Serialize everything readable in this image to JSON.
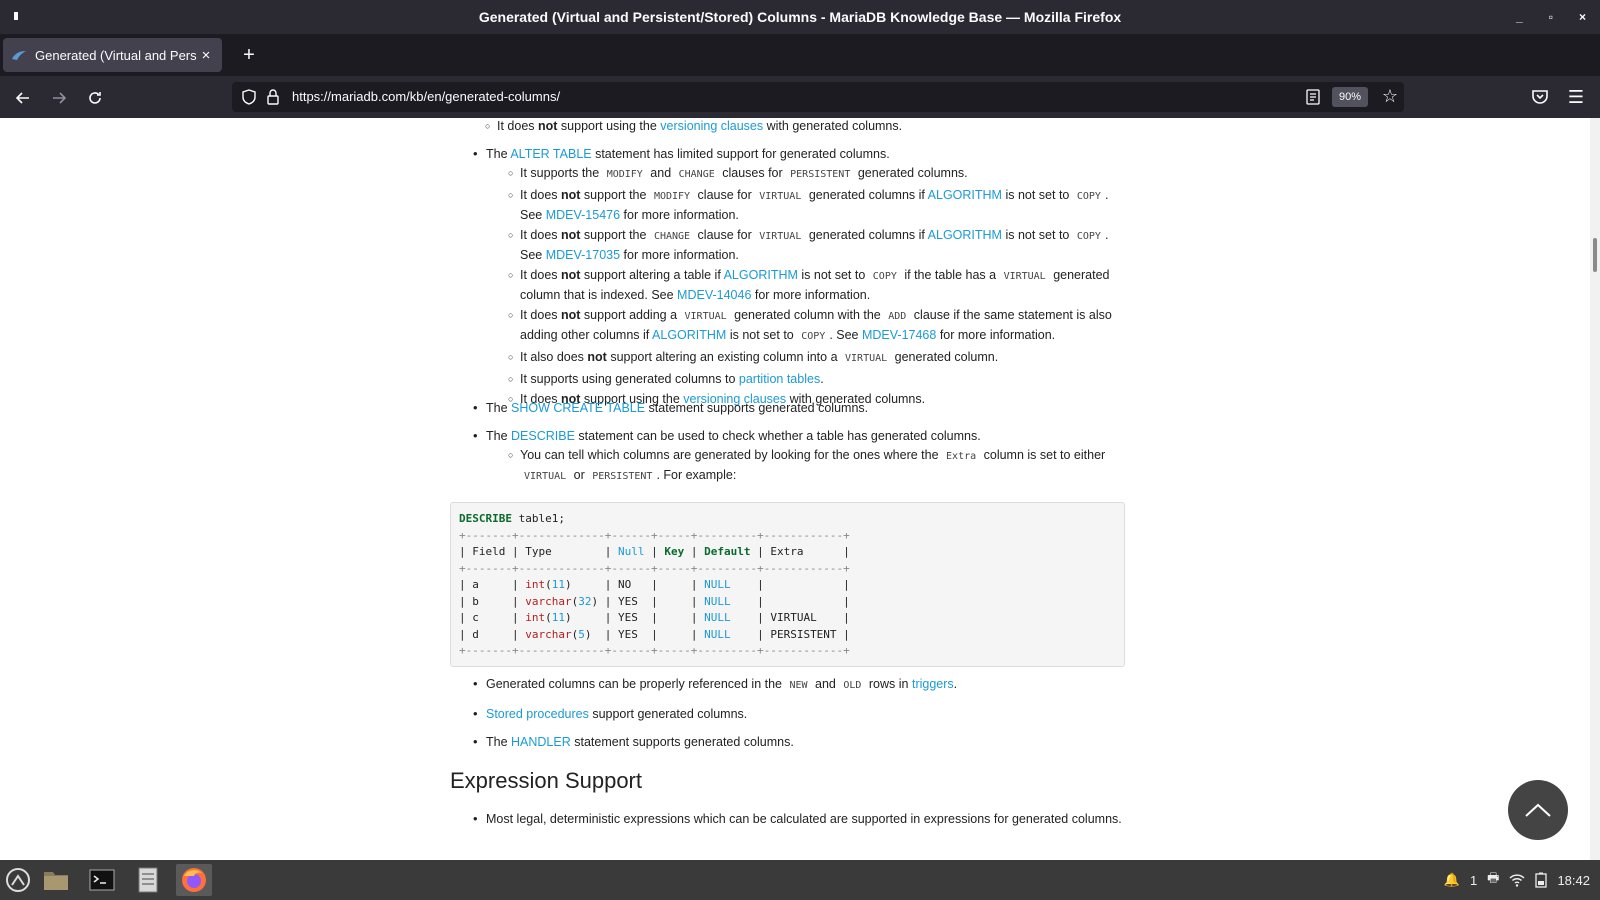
{
  "window": {
    "title": "Generated (Virtual and Persistent/Stored) Columns - MariaDB Knowledge Base — Mozilla Firefox",
    "controls": [
      "_",
      "▫",
      "×"
    ]
  },
  "tab": {
    "label": "Generated (Virtual and Pers",
    "close": "×",
    "new_tab": "+"
  },
  "nav": {
    "url": "https://mariadb.com/kb/en/generated-columns/",
    "zoom": "90%"
  },
  "content": {
    "top_item": {
      "pre": "It does ",
      "bold": "not",
      "mid": " support using the ",
      "link": "versioning clauses",
      "post": " with generated columns."
    },
    "alter": {
      "pre": "The ",
      "link": "ALTER TABLE",
      "post": " statement has limited support for generated columns.",
      "items": [
        {
          "t1": "It supports the ",
          "c1": "MODIFY",
          "t2": " and ",
          "c2": "CHANGE",
          "t3": " clauses for ",
          "c3": "PERSISTENT",
          "t4": " generated columns."
        },
        {
          "t1": "It does ",
          "b": "not",
          "t2": " support the ",
          "c1": "MODIFY",
          "t3": " clause for ",
          "c2": "VIRTUAL",
          "t4": " generated columns if ",
          "l1": "ALGORITHM",
          "t5": " is not set to ",
          "c3": "COPY",
          "t6": ". See ",
          "l2": "MDEV-15476",
          "t7": " for more information."
        },
        {
          "t1": "It does ",
          "b": "not",
          "t2": " support the ",
          "c1": "CHANGE",
          "t3": " clause for ",
          "c2": "VIRTUAL",
          "t4": " generated columns if ",
          "l1": "ALGORITHM",
          "t5": " is not set to ",
          "c3": "COPY",
          "t6": ". See ",
          "l2": "MDEV-17035",
          "t7": " for more information."
        },
        {
          "t1": "It does ",
          "b": "not",
          "t2": " support altering a table if ",
          "l1": "ALGORITHM",
          "t3": " is not set to ",
          "c1": "COPY",
          "t4": " if the table has a ",
          "c2": "VIRTUAL",
          "t5": " generated column that is indexed. See ",
          "l2": "MDEV-14046",
          "t6": " for more information."
        },
        {
          "t1": "It does ",
          "b": "not",
          "t2": " support adding a ",
          "c1": "VIRTUAL",
          "t3": " generated column with the ",
          "c2": "ADD",
          "t4": " clause if the same statement is also adding other columns if ",
          "l1": "ALGORITHM",
          "t5": " is not set to ",
          "c3": "COPY",
          "t6": ". See ",
          "l2": "MDEV-17468",
          "t7": " for more information."
        },
        {
          "t1": "It also does ",
          "b": "not",
          "t2": " support altering an existing column into a ",
          "c1": "VIRTUAL",
          "t3": " generated column."
        },
        {
          "t1": "It supports using generated columns to ",
          "l1": "partition tables",
          "t2": "."
        },
        {
          "t1": "It does ",
          "b": "not",
          "t2": " support using the ",
          "l1": "versioning clauses",
          "t3": " with generated columns."
        }
      ]
    },
    "show_create": {
      "pre": "The ",
      "link": "SHOW CREATE TABLE",
      "post": " statement supports generated columns."
    },
    "describe": {
      "pre": "The ",
      "link": "DESCRIBE",
      "post": " statement can be used to check whether a table has generated columns.",
      "sub": {
        "t1": "You can tell which columns are generated by looking for the ones where the ",
        "c1": "Extra",
        "t2": " column is set to either ",
        "c2": "VIRTUAL",
        "t3": " or ",
        "c3": "PERSISTENT",
        "t4": ". For example:"
      }
    },
    "code": {
      "cmd_kw": "DESCRIBE",
      "cmd_rest": " table1;",
      "border": "+-------+-------------+------+-----+---------+------------+",
      "headers": [
        "Field",
        "Type",
        "Null",
        "Key",
        "Default",
        "Extra"
      ],
      "rows": [
        {
          "field": "a",
          "type_fn": "int",
          "type_num": "11",
          "null": "NO",
          "key": "",
          "default": "NULL",
          "extra": ""
        },
        {
          "field": "b",
          "type_fn": "varchar",
          "type_num": "32",
          "null": "YES",
          "key": "",
          "default": "NULL",
          "extra": ""
        },
        {
          "field": "c",
          "type_fn": "int",
          "type_num": "11",
          "null": "YES",
          "key": "",
          "default": "NULL",
          "extra": "VIRTUAL"
        },
        {
          "field": "d",
          "type_fn": "varchar",
          "type_num": "5",
          "null": "YES",
          "key": "",
          "default": "NULL",
          "extra": "PERSISTENT"
        }
      ]
    },
    "after_code": [
      {
        "t1": "Generated columns can be properly referenced in the ",
        "c1": "NEW",
        "t2": " and ",
        "c2": "OLD",
        "t3": " rows in ",
        "l1": "triggers",
        "t4": "."
      },
      {
        "l1": "Stored procedures",
        "t1": " support generated columns."
      },
      {
        "t1": "The ",
        "l1": "HANDLER",
        "t2": " statement supports generated columns."
      }
    ],
    "section_title": "Expression Support",
    "expr_item": "Most legal, deterministic expressions which can be calculated are supported in expressions for generated columns."
  },
  "taskbar": {
    "notif_count": "1",
    "clock": "18:42"
  },
  "colors": {
    "link": "#1b9ad6",
    "titlebar": "#2b2a33",
    "tabbar": "#1c1b22",
    "taskbar": "#3a3a3a"
  }
}
